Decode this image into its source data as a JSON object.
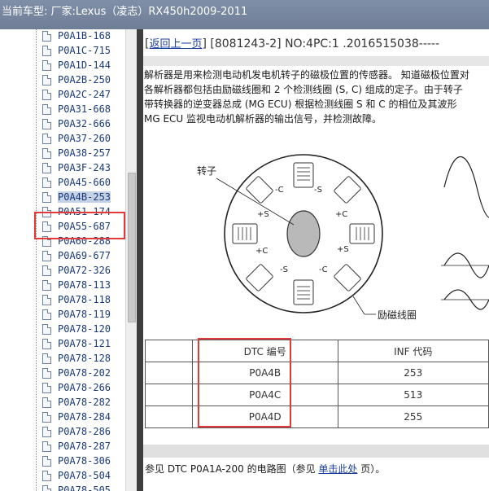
{
  "titlebar": {
    "text": "当前车型:  厂家:Lexus（凌志）RX450h2009-2011"
  },
  "tree": {
    "items": [
      "P0A1B-168",
      "P0A1C-715",
      "P0A1D-144",
      "P0A2B-250",
      "P0A2C-247",
      "P0A31-668",
      "P0A32-666",
      "P0A37-260",
      "P0A38-257",
      "P0A3F-243",
      "P0A45-660",
      "P0A4B-253",
      "P0A51-174",
      "P0A55-687",
      "P0A60-288",
      "P0A69-677",
      "P0A72-326",
      "P0A78-113",
      "P0A78-118",
      "P0A78-119",
      "P0A78-120",
      "P0A78-121",
      "P0A78-128",
      "P0A78-202",
      "P0A78-266",
      "P0A78-282",
      "P0A78-284",
      "P0A78-286",
      "P0A78-287",
      "P0A78-306",
      "P0A78-504",
      "P0A78-505"
    ],
    "selected": "P0A4B-253"
  },
  "doc": {
    "back_link": "返回上一页",
    "header": " [8081243-2] NO:4PC:1 .2016515038-----",
    "description": [
      "解析器是用来检测电动机发电机转子的磁极位置的传感器。 知道磁极位置对",
      "各解析器都包括由励磁线圈和 2 个检测线圈 (S, C) 组成的定子。由于转子",
      "带转换器的逆变器总成 (MG ECU) 根据检测线圈 S 和 C 的相位及其波形",
      "MG ECU 监视电动机解析器的输出信号，并检测故障。"
    ],
    "figure": {
      "rotor_label": "转子",
      "coil_label": "励磁线圈",
      "coil_tags": [
        "-C",
        "-S",
        "+C",
        "+S",
        "+S",
        "+C",
        "-S",
        "-C"
      ]
    },
    "table": {
      "header": [
        "DTC 编号",
        "INF 代码"
      ],
      "rows": [
        [
          "P0A4B",
          "253"
        ],
        [
          "P0A4C",
          "513"
        ],
        [
          "P0A4D",
          "255"
        ]
      ]
    },
    "footnote": {
      "prefix": "参见 DTC P0A1A-200 的电路图（参见 ",
      "link": "单击此处",
      "suffix": " 页）。"
    }
  },
  "colors": {
    "highlight_box": "#e23a3a",
    "link": "#1a3ea0",
    "titlebar": "#7586a0"
  }
}
